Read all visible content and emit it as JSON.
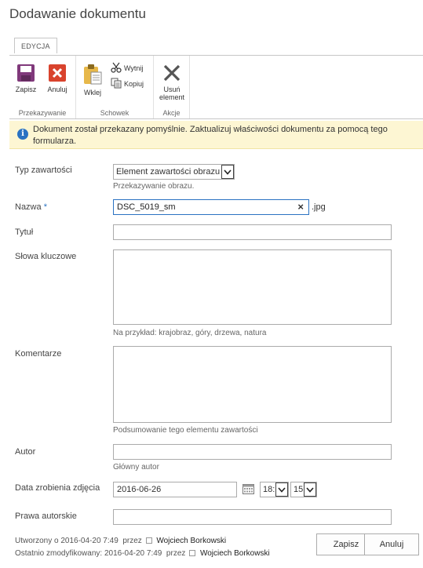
{
  "page": {
    "title": "Dodawanie dokumentu"
  },
  "ribbon": {
    "tab": "EDYCJA",
    "groups": {
      "commit": {
        "label": "Przekazywanie",
        "save": "Zapisz",
        "cancel": "Anuluj"
      },
      "clipboard": {
        "label": "Schowek",
        "paste": "Wklej",
        "cut": "Wytnij",
        "copy": "Kopiuj"
      },
      "actions": {
        "label": "Akcje",
        "delete_line1": "Usuń",
        "delete_line2": "element"
      }
    },
    "colors": {
      "save": "#80397b",
      "cancel": "#d9432d",
      "paste": "#e7b84a"
    }
  },
  "notice": {
    "text": "Dokument został przekazany pomyślnie. Zaktualizuj właściwości dokumentu za pomocą tego formularza.",
    "icon": "info-icon"
  },
  "form": {
    "content_type": {
      "label": "Typ zawartości",
      "value": "Element zawartości obrazu",
      "hint": "Przekazywanie obrazu."
    },
    "name": {
      "label": "Nazwa",
      "required_mark": "*",
      "value": "DSC_5019_sm",
      "extension": ".jpg",
      "clear": "×"
    },
    "title": {
      "label": "Tytuł",
      "value": ""
    },
    "keywords": {
      "label": "Słowa kluczowe",
      "value": "",
      "hint": "Na przykład: krajobraz, góry, drzewa, natura"
    },
    "comments": {
      "label": "Komentarze",
      "value": "",
      "hint": "Podsumowanie tego elementu zawartości"
    },
    "author": {
      "label": "Autor",
      "value": "",
      "hint": "Główny autor"
    },
    "date_taken": {
      "label": "Data zrobienia zdjęcia",
      "date": "2016-06-26",
      "hour": "18:",
      "minute": "15"
    },
    "copyright": {
      "label": "Prawa autorskie",
      "value": ""
    }
  },
  "footer": {
    "created_prefix": "Utworzony o",
    "created_date": "2016-04-20 7:49",
    "by": "przez",
    "created_user": "Wojciech Borkowski",
    "modified_prefix": "Ostatnio zmodyfikowany:",
    "modified_date": "2016-04-20 7:49",
    "modified_user": "Wojciech Borkowski",
    "save": "Zapisz",
    "cancel": "Anuluj"
  }
}
